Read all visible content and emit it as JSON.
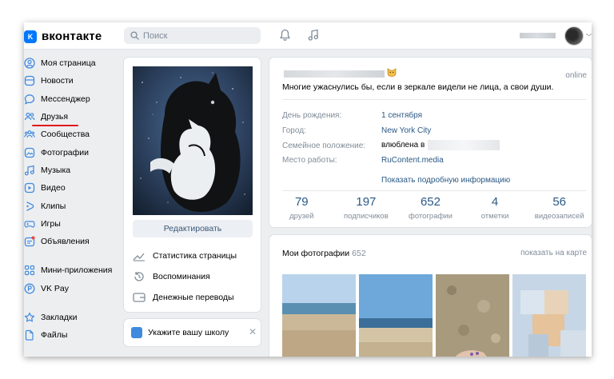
{
  "brand": {
    "logo_letter": "K",
    "name": "вконтакте"
  },
  "search": {
    "placeholder": "Поиск"
  },
  "sidebar": {
    "items": [
      {
        "label": "Моя страница",
        "icon": "user-circle-icon"
      },
      {
        "label": "Новости",
        "icon": "news-icon"
      },
      {
        "label": "Мессенджер",
        "icon": "chat-icon"
      },
      {
        "label": "Друзья",
        "icon": "friends-icon"
      },
      {
        "label": "Сообщества",
        "icon": "communities-icon"
      },
      {
        "label": "Фотографии",
        "icon": "photo-icon"
      },
      {
        "label": "Музыка",
        "icon": "music-icon"
      },
      {
        "label": "Видео",
        "icon": "video-icon"
      },
      {
        "label": "Клипы",
        "icon": "clips-icon"
      },
      {
        "label": "Игры",
        "icon": "games-icon"
      },
      {
        "label": "Объявления",
        "icon": "ads-icon"
      }
    ],
    "extra": [
      {
        "label": "Мини-приложения",
        "icon": "apps-icon"
      },
      {
        "label": "VK Pay",
        "icon": "vkpay-icon"
      }
    ],
    "bottom": [
      {
        "label": "Закладки",
        "icon": "bookmark-icon"
      },
      {
        "label": "Файлы",
        "icon": "file-icon"
      }
    ],
    "highlight_color": "#e0181b"
  },
  "profile": {
    "edit_label": "Редактировать",
    "actions": [
      {
        "label": "Статистика страницы",
        "icon": "stats-icon"
      },
      {
        "label": "Воспоминания",
        "icon": "memories-icon"
      },
      {
        "label": "Денежные переводы",
        "icon": "transfer-icon"
      }
    ],
    "school_prompt": "Укажите вашу школу",
    "close_glyph": "✕"
  },
  "info": {
    "status": "Многие ужаснулись бы, если в зеркале видели не лица, а свои души.",
    "online": "online",
    "rows": [
      {
        "label": "День рождения:",
        "value": "1 сентября"
      },
      {
        "label": "Город:",
        "value": "New York City"
      },
      {
        "label": "Семейное положение:",
        "value": "влюблена в"
      },
      {
        "label": "Место работы:",
        "value": "RuContent.media"
      }
    ],
    "details_link": "Показать подробную информацию"
  },
  "counters": [
    {
      "value": "79",
      "label": "друзей"
    },
    {
      "value": "197",
      "label": "подписчиков"
    },
    {
      "value": "652",
      "label": "фотографии"
    },
    {
      "value": "4",
      "label": "отметки"
    },
    {
      "value": "56",
      "label": "видеозаписей"
    }
  ],
  "photos": {
    "title": "Мои фотографии",
    "count": "652",
    "map_link": "показать на карте"
  },
  "colors": {
    "accent": "#0077ff",
    "link": "#2a5885",
    "muted": "#818c99",
    "background": "#edeef0"
  }
}
